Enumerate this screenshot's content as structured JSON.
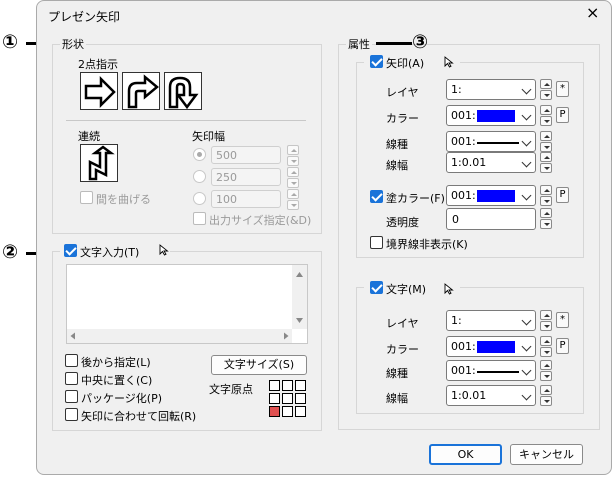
{
  "window": {
    "title": "プレゼン矢印",
    "close_icon": "×"
  },
  "annotations": [
    "①",
    "②",
    "③"
  ],
  "shape": {
    "group_label": "形状",
    "two_point_label": "2点指示",
    "continuous_label": "連続",
    "bend_label": "間を曲げる",
    "arrow_width_label": "矢印幅",
    "widths": [
      "500",
      "250",
      "100"
    ],
    "output_size_label": "出力サイズ指定(&D)"
  },
  "text_input": {
    "label": "文字入力(T)",
    "options": [
      "後から指定(L)",
      "中央に置く(C)",
      "パッケージ化(P)",
      "矢印に合わせて回転(R)"
    ],
    "size_button": "文字サイズ(S)",
    "origin_label": "文字原点"
  },
  "attributes": {
    "group_label": "属性",
    "arrow_section": {
      "label": "矢印(A)",
      "layer_label": "レイヤ",
      "layer_value": "1:",
      "star": "*",
      "color_label": "カラー",
      "color_value": "001:",
      "p": "P",
      "line_type_label": "線種",
      "line_type_value": "001:",
      "line_width_label": "線幅",
      "line_width_value": "1:0.01",
      "fill_label": "塗カラー(F)",
      "fill_value": "001:",
      "transparency_label": "透明度",
      "transparency_value": "0",
      "hide_border_label": "境界線非表示(K)"
    },
    "text_section": {
      "label": "文字(M)",
      "layer_label": "レイヤ",
      "layer_value": "1:",
      "star": "*",
      "color_label": "カラー",
      "color_value": "001:",
      "p": "P",
      "line_type_label": "線種",
      "line_type_value": "001:",
      "line_width_label": "線幅",
      "line_width_value": "1:0.01"
    }
  },
  "buttons": {
    "ok": "OK",
    "cancel": "キャンセル"
  },
  "colors": {
    "accent": "#1a73d9",
    "swatch": "#0000ff",
    "origin_selected": "#e05050"
  }
}
